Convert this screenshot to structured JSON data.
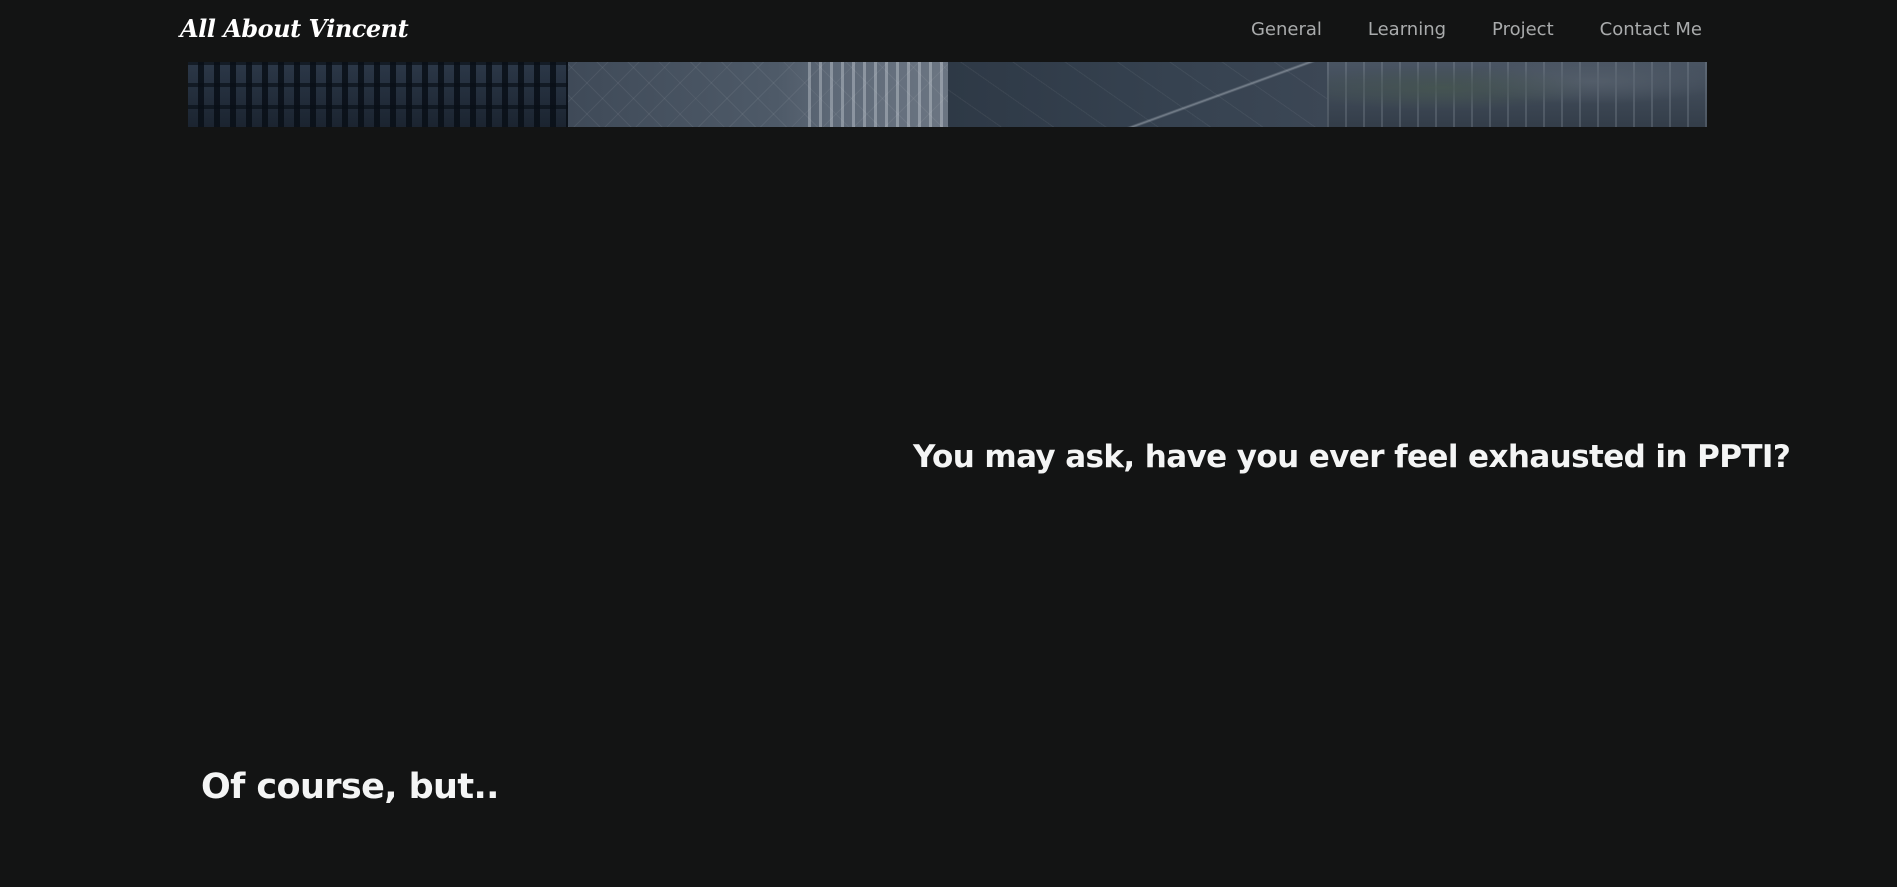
{
  "header": {
    "brand": "All About Vincent",
    "nav": [
      {
        "label": "General"
      },
      {
        "label": "Learning"
      },
      {
        "label": "Project"
      },
      {
        "label": "Contact Me"
      }
    ]
  },
  "content": {
    "question": "You may ask, have you ever feel exhausted in PPTI?",
    "answer": "Of course, but.."
  },
  "colors": {
    "background": "#131414",
    "nav_text": "#a9abac",
    "text": "#f4f5f5"
  }
}
